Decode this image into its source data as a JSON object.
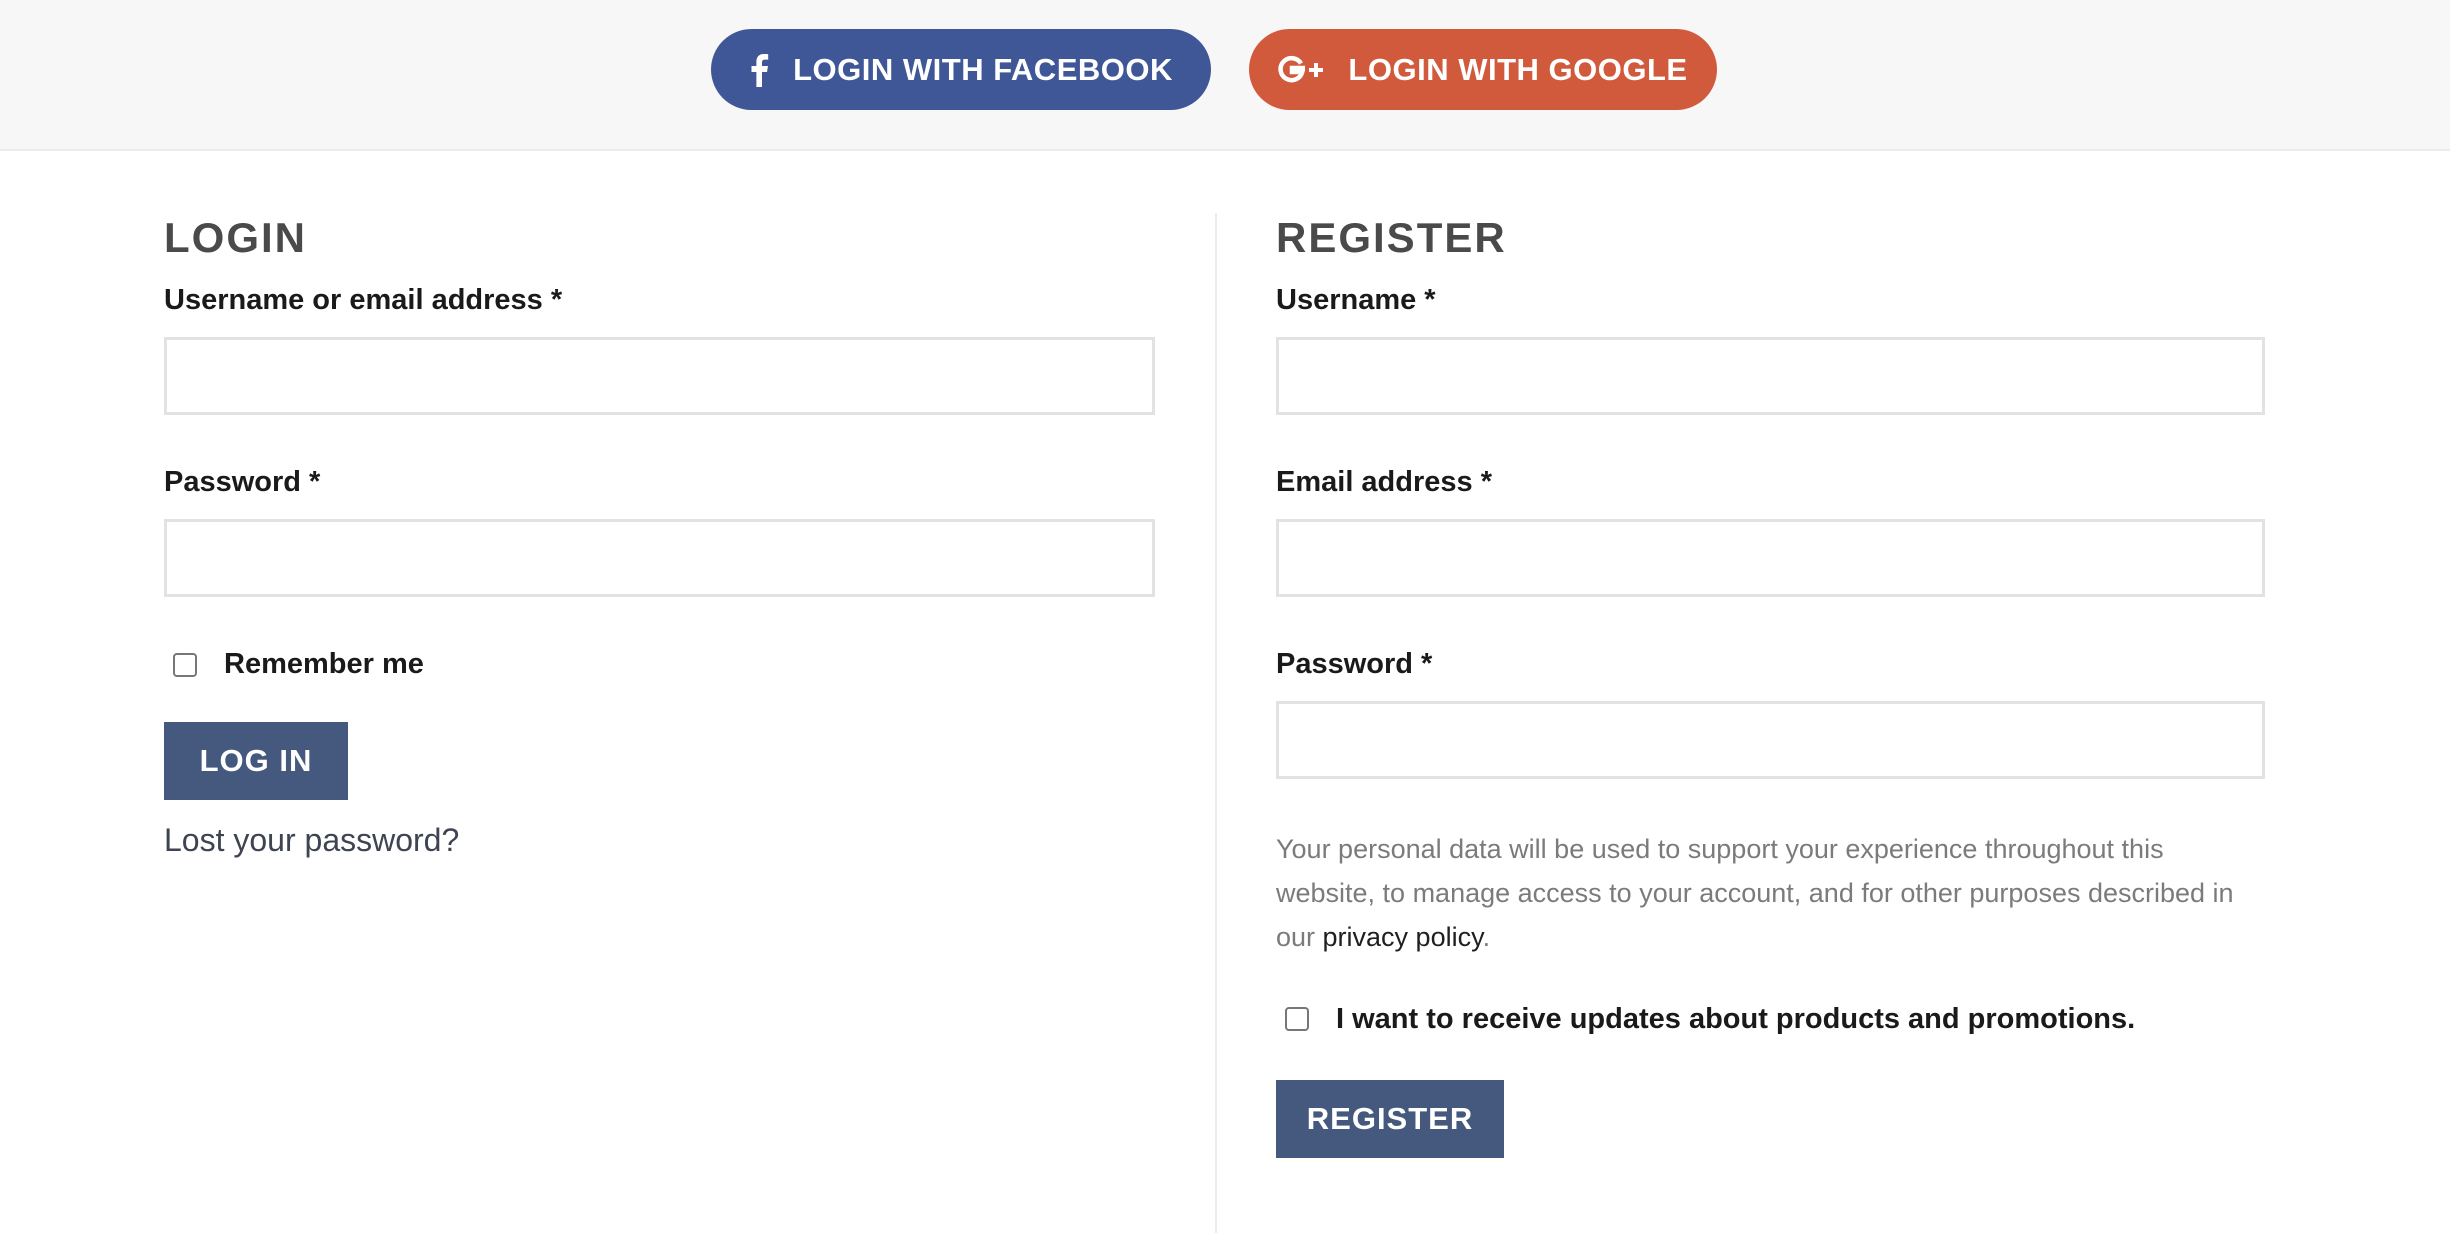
{
  "social": {
    "facebook_label": "LOGIN WITH FACEBOOK",
    "google_label": "LOGIN WITH GOOGLE",
    "facebook_color": "#3f5797",
    "google_color": "#d15a3d"
  },
  "login": {
    "title": "LOGIN",
    "username_label": "Username or email address *",
    "password_label": "Password *",
    "remember_label": "Remember me",
    "submit_label": "LOG IN",
    "lost_password": "Lost your password?"
  },
  "register": {
    "title": "REGISTER",
    "username_label": "Username *",
    "email_label": "Email address *",
    "password_label": "Password *",
    "privacy_text": "Your personal data will be used to support your experience throughout this website, to manage access to your account, and for other purposes described in our ",
    "privacy_link": "privacy policy",
    "privacy_end": ".",
    "updates_label": "I want to receive updates about products and promotions.",
    "submit_label": "REGISTER"
  },
  "colors": {
    "button_primary": "#45597e",
    "text_heading": "#4a4a4a",
    "input_border": "#e2e2e2"
  }
}
